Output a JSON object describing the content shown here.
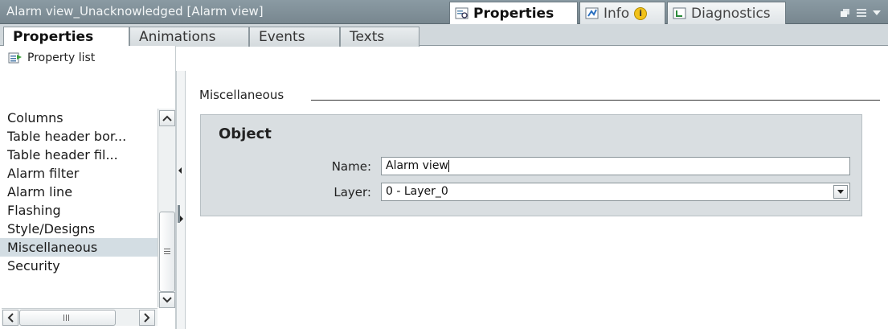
{
  "window": {
    "title": "Alarm view_Unacknowledged [Alarm view]",
    "tabs": [
      {
        "label": "Properties",
        "icon": "properties-icon",
        "active": true
      },
      {
        "label": "Info",
        "icon": "info-icon",
        "active": false
      },
      {
        "label": "Diagnostics",
        "icon": "diagnostics-icon",
        "active": false
      }
    ]
  },
  "subtabs": [
    "Properties",
    "Animations",
    "Events",
    "Texts"
  ],
  "sidebar": {
    "header": "Property list",
    "items": [
      "Columns",
      "Table header bor...",
      "Table header fil...",
      "Alarm filter",
      "Alarm line",
      "Flashing",
      "Style/Designs",
      "Miscellaneous",
      "Security"
    ],
    "selected": "Miscellaneous"
  },
  "main": {
    "section_title": "Miscellaneous",
    "group_title": "Object",
    "name_label": "Name:",
    "name_value": "Alarm view",
    "layer_label": "Layer:",
    "layer_value": "0 - Layer_0"
  },
  "colors": {
    "titlebar": "#7f8e96",
    "panel": "#d1d8dc",
    "group": "#d9dee1",
    "selection": "#d3dde3"
  }
}
